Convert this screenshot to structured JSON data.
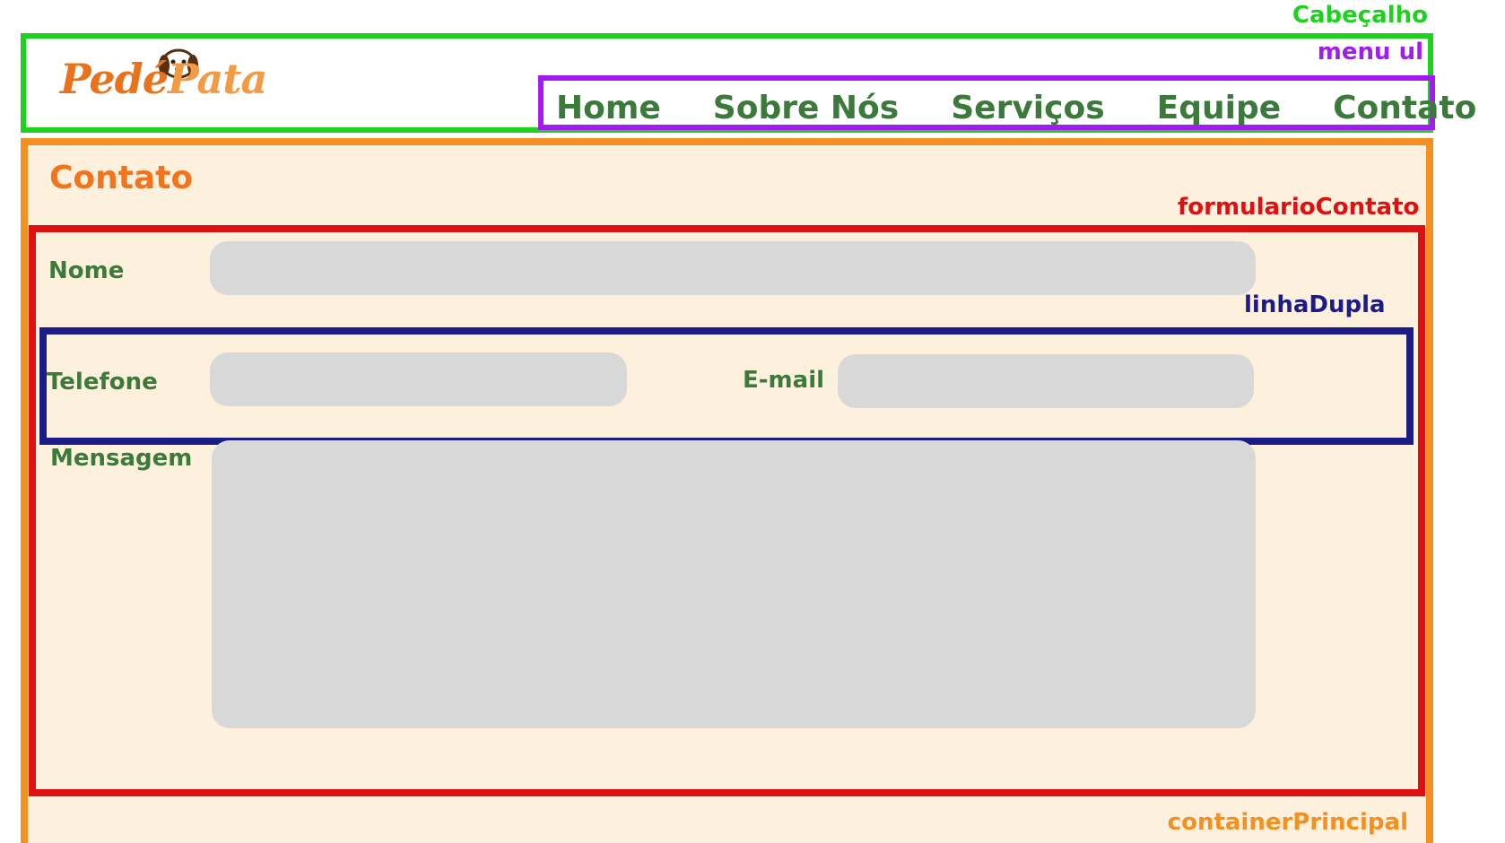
{
  "annotations": {
    "cabecalho": "Cabeçalho",
    "menu_ul": "menu ul",
    "formulario": "formularioContato",
    "linha_dupla": "linhaDupla",
    "container": "containerPrincipal"
  },
  "logo": {
    "part1": "Pedé",
    "part2": "Pata"
  },
  "menu": {
    "items": [
      "Home",
      "Sobre Nós",
      "Serviços",
      "Equipe",
      "Contato"
    ]
  },
  "page": {
    "title": "Contato"
  },
  "form": {
    "nome_label": "Nome",
    "telefone_label": "Telefone",
    "email_label": "E-mail",
    "mensagem_label": "Mensagem",
    "nome_value": "",
    "telefone_value": "",
    "email_value": "",
    "mensagem_value": ""
  },
  "colors": {
    "header_border": "#1fd11f",
    "menu_border": "#a21cf0",
    "container_border": "#f39021",
    "form_border": "#dd1111",
    "linha_border": "#1c1c87",
    "label_green": "#3c7a3c",
    "title_orange": "#f2751d",
    "field_gray": "#d8d8d8",
    "container_bg": "#fdf0dd"
  }
}
